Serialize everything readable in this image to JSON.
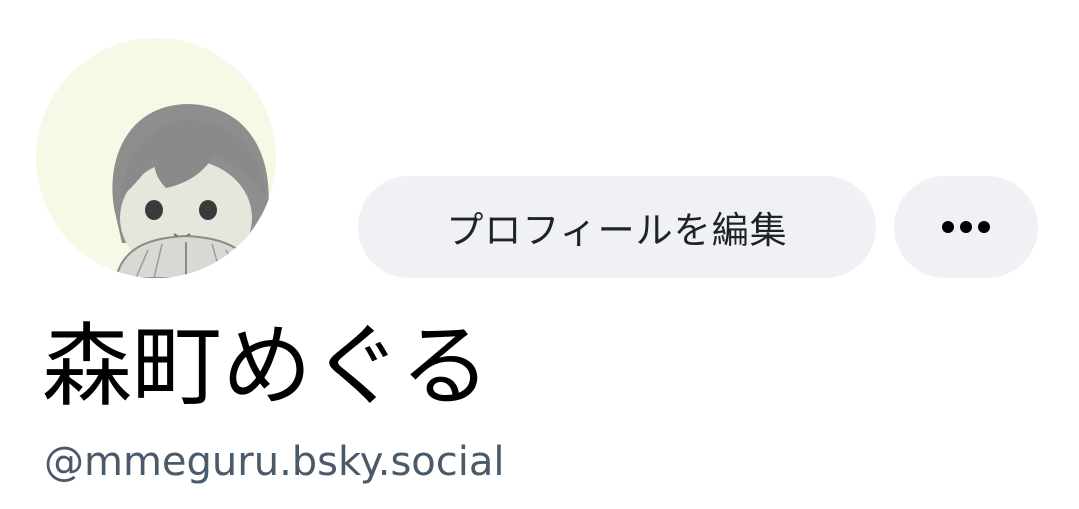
{
  "profile": {
    "display_name": "森町めぐる",
    "handle": "@mmeguru.bsky.social"
  },
  "actions": {
    "edit_profile_label": "プロフィールを編集",
    "more_icon": "more-horizontal-icon"
  },
  "colors": {
    "button_bg": "#f0f1f4",
    "handle_text": "#4b5a6a",
    "avatar_bg": "#f8f8e8"
  }
}
